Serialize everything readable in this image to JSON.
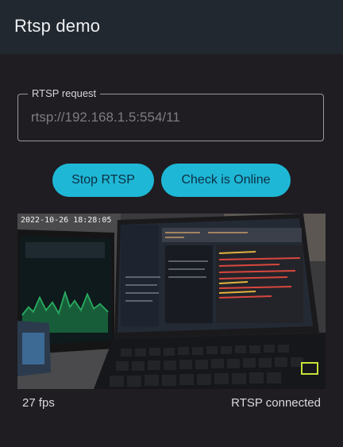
{
  "app": {
    "title": "Rtsp demo"
  },
  "form": {
    "label": "RTSP request",
    "placeholder": "rtsp://192.168.1.5:554/11"
  },
  "buttons": {
    "stop": "Stop RTSP",
    "check": "Check is Online"
  },
  "preview": {
    "timestamp": "2022-10-26 18:28:05"
  },
  "status": {
    "fps": "27 fps",
    "connection": "RTSP connected"
  },
  "colors": {
    "background": "#1f1d22",
    "appbar": "#222830",
    "accent": "#1fb7d6"
  }
}
